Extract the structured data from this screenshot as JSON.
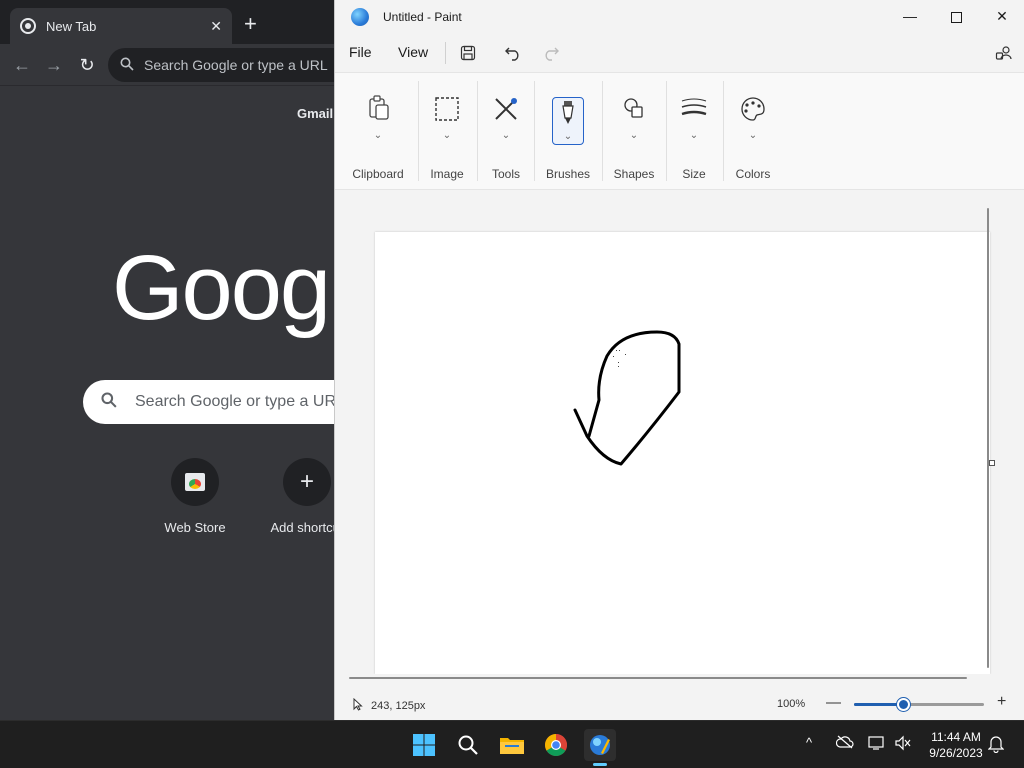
{
  "chrome": {
    "tab_title": "New Tab",
    "tab_close": "✕",
    "new_tab": "+",
    "omnibox_placeholder": "Search Google or type a URL",
    "gmail": "Gmail",
    "logo_text": "Google",
    "ntp_search_placeholder": "Search Google or type a URL",
    "shortcuts": [
      {
        "label": "Web Store"
      },
      {
        "label": "Add shortcut",
        "glyph": "+"
      }
    ]
  },
  "paint": {
    "title": "Untitled - Paint",
    "menu": {
      "file": "File",
      "view": "View"
    },
    "ribbon": [
      {
        "label": "Clipboard",
        "icon": "clipboard-icon"
      },
      {
        "label": "Image",
        "icon": "select-icon"
      },
      {
        "label": "Tools",
        "icon": "tools-icon"
      },
      {
        "label": "Brushes",
        "icon": "brush-icon"
      },
      {
        "label": "Shapes",
        "icon": "shapes-icon"
      },
      {
        "label": "Size",
        "icon": "size-icon"
      },
      {
        "label": "Colors",
        "icon": "palette-icon"
      }
    ],
    "status": {
      "cursor_position": "243, 125px",
      "zoom": "100%",
      "zoom_level_fraction": 0.38
    }
  },
  "taskbar": {
    "time": "11:44 AM",
    "date": "9/26/2023",
    "accent": "#60cdff"
  }
}
